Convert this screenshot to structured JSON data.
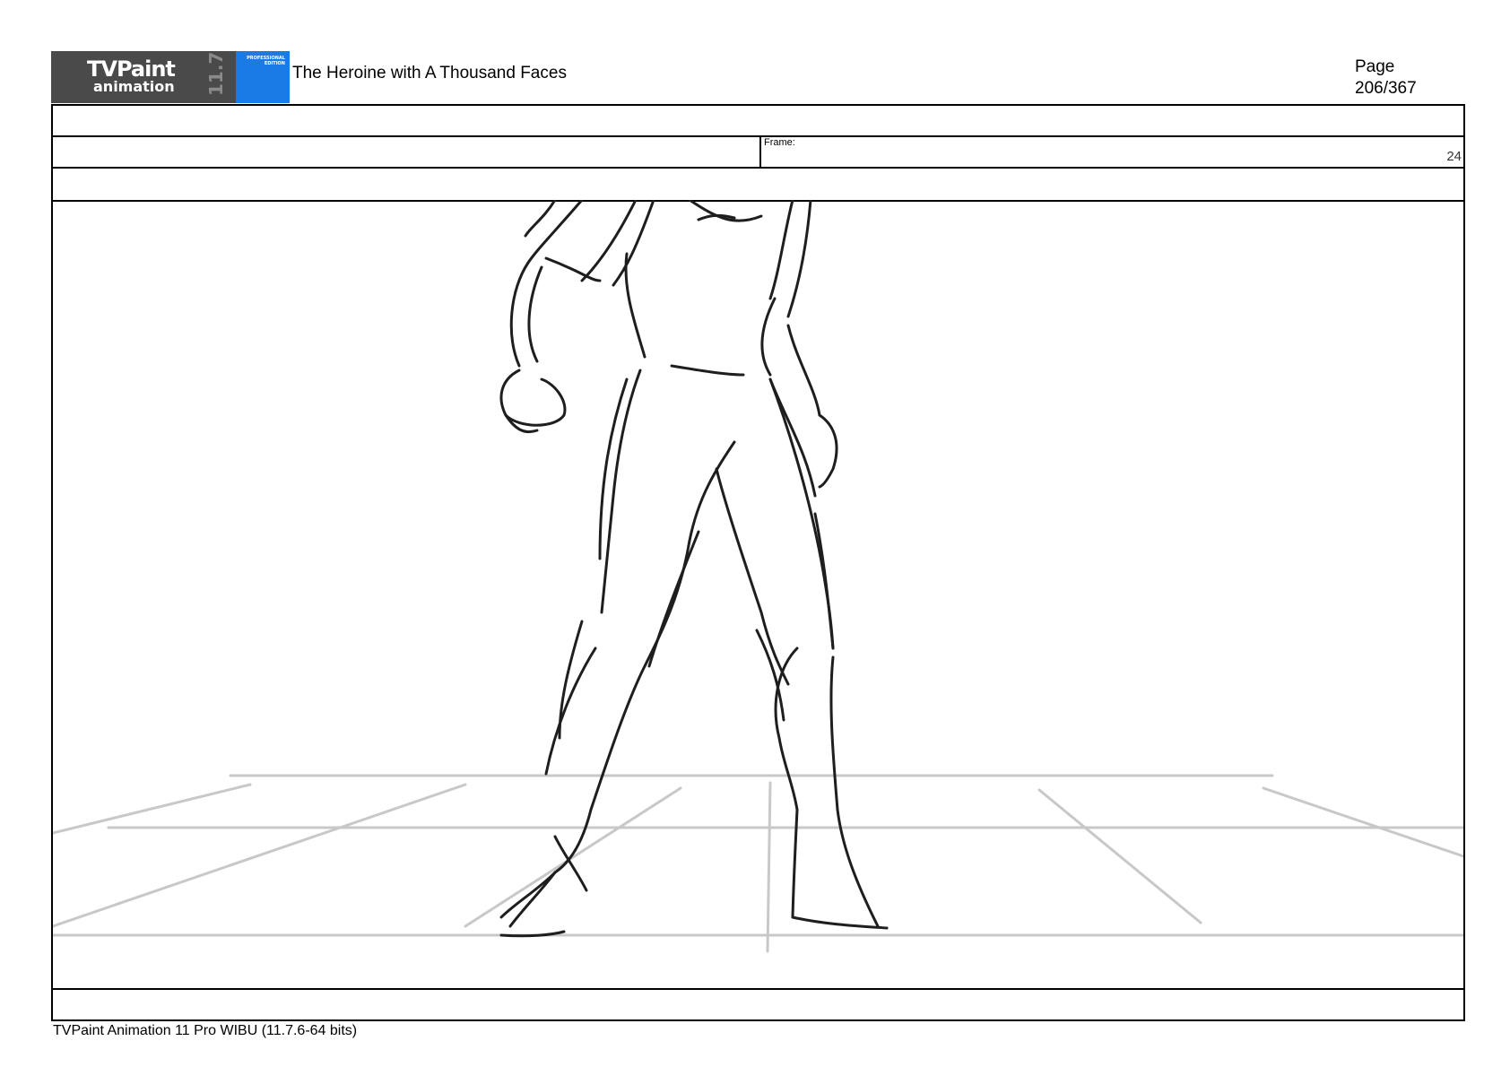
{
  "header": {
    "logo": {
      "word1": "TVPaint",
      "word2": "animation",
      "version": "11.7",
      "edition": "PROFESSIONAL EDITION"
    },
    "title": "The Heroine with A Thousand Faces",
    "page_label": "Page",
    "page_number": "206/367"
  },
  "panel": {
    "frame_label": "Frame:",
    "frame_number": "24"
  },
  "footer": {
    "software": "TVPaint Animation 11 Pro WIBU (11.7.6-64 bits)"
  }
}
